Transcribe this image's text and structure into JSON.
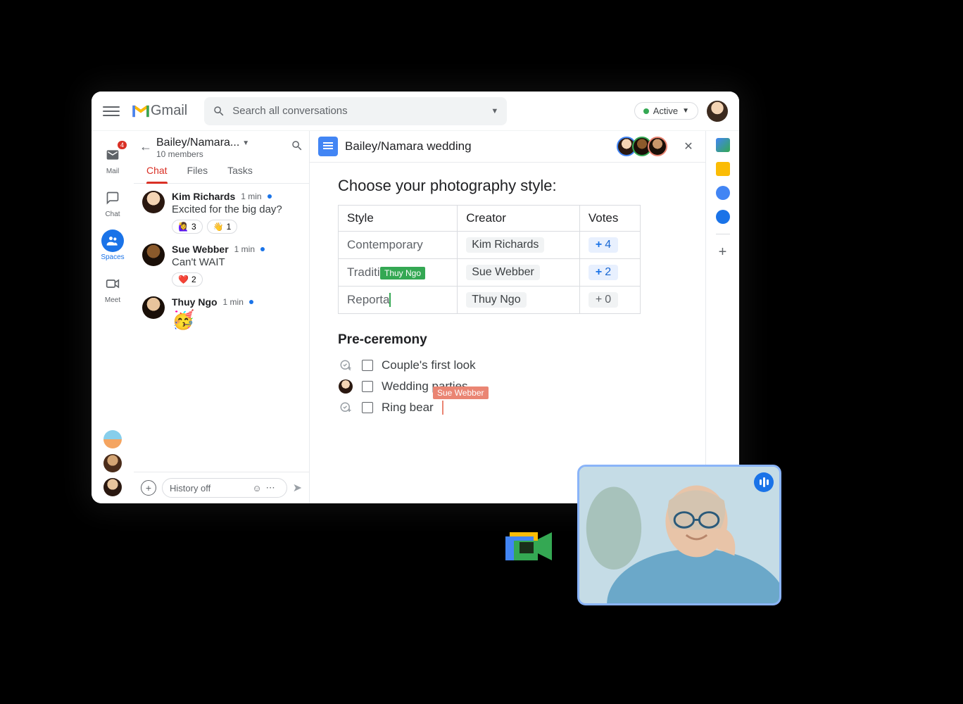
{
  "header": {
    "app_name": "Gmail",
    "search_placeholder": "Search all conversations",
    "status_label": "Active"
  },
  "nav": {
    "items": [
      {
        "label": "Mail",
        "badge": "4"
      },
      {
        "label": "Chat"
      },
      {
        "label": "Spaces"
      },
      {
        "label": "Meet"
      }
    ]
  },
  "space": {
    "title": "Bailey/Namara...",
    "members": "10 members",
    "tabs": [
      "Chat",
      "Files",
      "Tasks"
    ]
  },
  "messages": [
    {
      "name": "Kim Richards",
      "time": "1 min",
      "body": "Excited for the big day?",
      "reacts": [
        {
          "emoji": "🙋‍♀️",
          "count": "3"
        },
        {
          "emoji": "👋",
          "count": "1"
        }
      ]
    },
    {
      "name": "Sue Webber",
      "time": "1 min",
      "body": "Can't WAIT",
      "reacts": [
        {
          "emoji": "❤️",
          "count": "2"
        }
      ]
    },
    {
      "name": "Thuy Ngo",
      "time": "1 min",
      "body": "🥳",
      "reacts": []
    }
  ],
  "compose": {
    "history_label": "History off"
  },
  "doc": {
    "title": "Bailey/Namara wedding",
    "heading": "Choose your photography style:",
    "table_headers": [
      "Style",
      "Creator",
      "Votes"
    ],
    "rows": [
      {
        "style": "Contemporary",
        "creator": "Kim Richards",
        "votes": "4",
        "active": true
      },
      {
        "style": "Traditional",
        "creator": "Sue Webber",
        "votes": "2",
        "active": true
      },
      {
        "style": "Reporta",
        "creator": "Thuy Ngo",
        "votes": "0",
        "active": false
      }
    ],
    "cursor_tag_1": "Thuy Ngo",
    "section2": "Pre-ceremony",
    "checks": [
      "Couple's first look",
      "Wedding parties",
      "Ring bear"
    ],
    "cursor_tag_2": "Sue Webber"
  }
}
